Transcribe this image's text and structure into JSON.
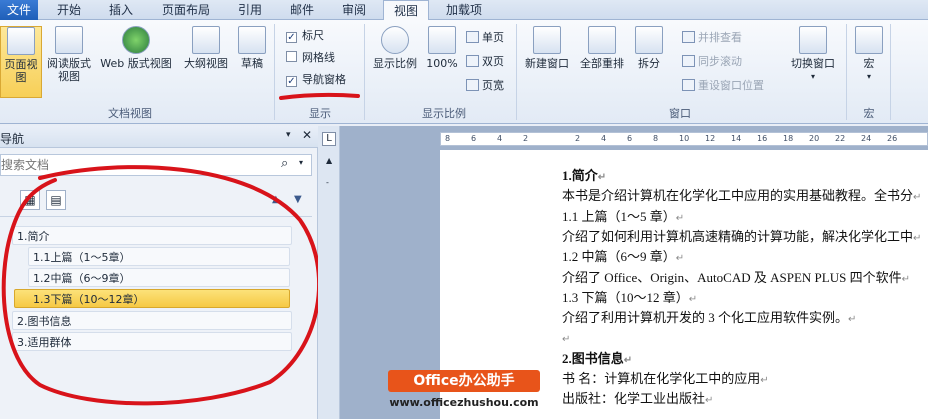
{
  "tabs": [
    "文件",
    "开始",
    "插入",
    "页面布局",
    "引用",
    "邮件",
    "审阅",
    "视图",
    "加载项"
  ],
  "ribbon": {
    "doc_views": {
      "buttons": [
        "页面视图",
        "阅读版式\n视图",
        "Web 版式视图",
        "大纲视图",
        "草稿"
      ],
      "label": "文档视图"
    },
    "show": {
      "ruler": "标尺",
      "gridlines": "网格线",
      "nav_pane": "导航窗格",
      "label": "显示"
    },
    "zoom": {
      "zoom_btn": "显示比例",
      "hundred": "100%",
      "one_page": "单页",
      "two_pages": "双页",
      "page_width": "页宽",
      "label": "显示比例"
    },
    "window": {
      "new_window": "新建窗口",
      "arrange_all": "全部重排",
      "split": "拆分",
      "side_by_side": "并排查看",
      "sync_scroll": "同步滚动",
      "reset_pos": "重设窗口位置",
      "switch": "切换窗口",
      "label": "窗口"
    },
    "macros": {
      "macro": "宏",
      "label": "宏"
    }
  },
  "nav": {
    "title": "导航",
    "search_placeholder": "搜索文档",
    "items": [
      "1.简介",
      "1.1上篇（1～5章）",
      "1.2中篇（6～9章）",
      "1.3下篇（10～12章）",
      "2.图书信息",
      "3.适用群体"
    ]
  },
  "ruler": [
    "8",
    "6",
    "4",
    "2",
    "",
    "2",
    "4",
    "6",
    "8",
    "10",
    "12",
    "14",
    "16",
    "18",
    "20",
    "22",
    "24",
    "26"
  ],
  "doc": [
    {
      "text": "1.简介",
      "bold": true
    },
    {
      "text": "本书是介绍计算机在化学化工中应用的实用基础教程。全书分",
      "bold": false
    },
    {
      "text": "1.1 上篇（1～5 章）",
      "bold": false
    },
    {
      "text": "介绍了如何利用计算机高速精确的计算功能，解决化学化工中",
      "bold": false
    },
    {
      "text": "1.2 中篇（6～9 章）",
      "bold": false
    },
    {
      "text": "介绍了 Office、Origin、AutoCAD 及 ASPEN PLUS 四个软件",
      "bold": false
    },
    {
      "text": "1.3 下篇（10～12 章）",
      "bold": false
    },
    {
      "text": "介绍了利用计算机开发的 3 个化工应用软件实例。",
      "bold": false
    },
    {
      "text": "",
      "bold": false
    },
    {
      "text": "2.图书信息",
      "bold": true
    },
    {
      "text": "书  名：计算机在化学化工中的应用",
      "bold": false
    },
    {
      "text": "出版社：化学工业出版社",
      "bold": false
    }
  ],
  "watermark": {
    "badge": "Office办公助手",
    "url": "www.officezhushou.com"
  },
  "colors": {
    "accent": "#1f5fb8",
    "selected": "#f6c944",
    "annotation": "#d8131a",
    "watermark": "#e8541a"
  }
}
